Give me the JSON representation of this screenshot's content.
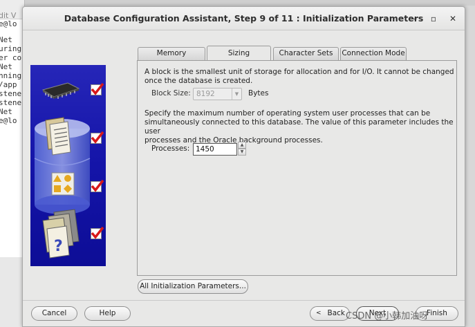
{
  "background_terminal": {
    "menu_text": "dit  V",
    "lines": [
      "e@lo",
      "",
      "Net",
      "uring",
      "er co",
      "Net",
      "nning",
      "/app",
      "stene",
      "stene",
      "Net",
      "e@lo"
    ]
  },
  "window": {
    "title": "Database Configuration Assistant, Step 9 of 11 : Initialization Parameters",
    "minimize_glyph": "–",
    "maximize_glyph": "▫",
    "close_glyph": "✕"
  },
  "side_panel": {
    "icons": [
      "memory-chip-icon",
      "database-documents-icon",
      "shapes-icon",
      "help-folder-icon"
    ],
    "checked": [
      true,
      true,
      true,
      true
    ],
    "accent": "#1a1aac"
  },
  "tabs": [
    {
      "label": "Memory",
      "active": false
    },
    {
      "label": "Sizing",
      "active": true
    },
    {
      "label": "Character Sets",
      "active": false
    },
    {
      "label": "Connection Mode",
      "active": false
    }
  ],
  "sizing": {
    "block_desc_line1": "A block is the smallest unit of storage for allocation and for I/O. It cannot be changed",
    "block_desc_line2": "once the database is created.",
    "block_size_label": "Block Size:",
    "block_size_value": "8192",
    "block_size_unit": "Bytes",
    "proc_desc_line1": "Specify the maximum number of operating system user processes that can be",
    "proc_desc_line2": "simultaneously connected to this database. The value of this parameter includes the user",
    "proc_desc_line3": "processes and the Oracle background processes.",
    "processes_label": "Processes:",
    "processes_value": "1450"
  },
  "buttons": {
    "all_params": "All Initialization Parameters...",
    "cancel": "Cancel",
    "help": "Help",
    "back": "Back",
    "next": "Next",
    "finish": "Finish"
  },
  "watermark": "CSDN @小韩加油呀"
}
